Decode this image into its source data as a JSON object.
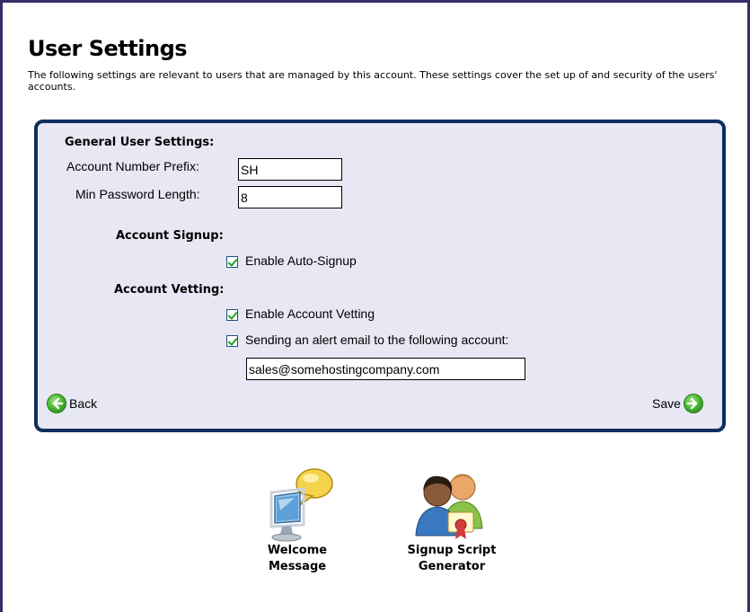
{
  "page": {
    "title": "User Settings",
    "description": "The following settings are relevant to users that are managed by this account. These settings cover the set up of and security of the users' accounts."
  },
  "general": {
    "heading": "General User Settings:",
    "prefix_label": "Account Number Prefix:",
    "prefix_value": "SH",
    "minpw_label": "Min Password Length:",
    "minpw_value": "8"
  },
  "signup": {
    "heading": "Account Signup:",
    "auto_signup_label": "Enable Auto-Signup",
    "auto_signup_checked": true
  },
  "vetting": {
    "heading": "Account Vetting:",
    "enable_label": "Enable Account Vetting",
    "enable_checked": true,
    "alert_label": "Sending an alert email to the following account:",
    "alert_checked": true,
    "alert_email": "sales@somehostingcompany.com"
  },
  "nav": {
    "back_label": "Back",
    "save_label": "Save"
  },
  "tools": [
    {
      "label_line1": "Welcome",
      "label_line2": "Message",
      "icon": "monitor-speech-icon"
    },
    {
      "label_line1": "Signup Script",
      "label_line2": "Generator",
      "icon": "users-certificate-icon"
    }
  ],
  "colors": {
    "panel_bg": "#e8e7f4",
    "panel_border": "#0d2e5e",
    "frame": "#3a2d6b",
    "arrow_green": "#3fae2b"
  }
}
